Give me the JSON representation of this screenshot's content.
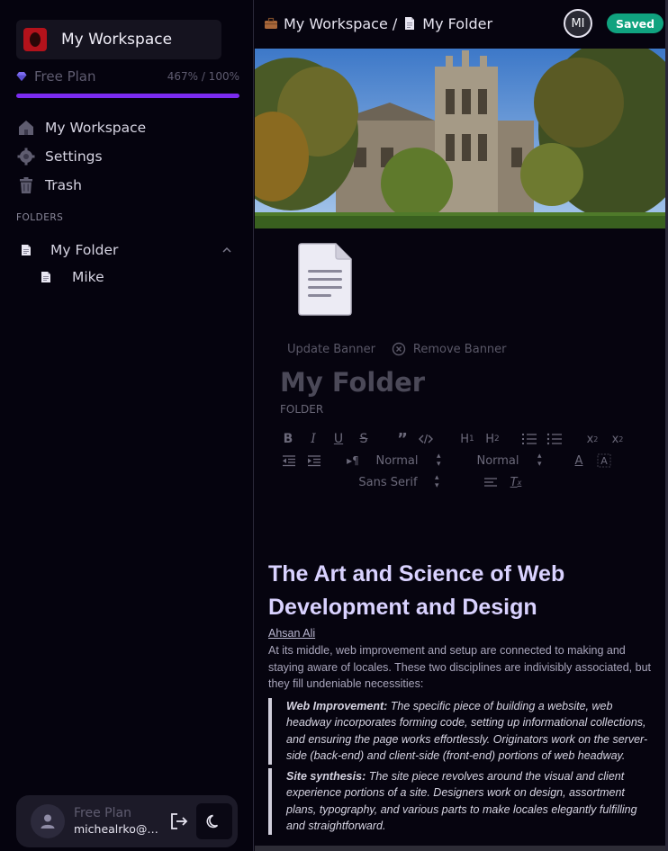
{
  "sidebar": {
    "workspace_name": "My Workspace",
    "plan": {
      "label": "Free Plan",
      "usage": "467% / 100%",
      "progress_fraction": 1.0
    },
    "nav": [
      {
        "label": "My Workspace",
        "icon": "home-icon"
      },
      {
        "label": "Settings",
        "icon": "gear-icon"
      },
      {
        "label": "Trash",
        "icon": "trash-icon"
      }
    ],
    "folders_title": "FOLDERS",
    "folder": {
      "label": "My Folder",
      "icon": "document-icon",
      "expanded": true
    },
    "files": [
      {
        "label": "Mike",
        "icon": "document-icon"
      }
    ],
    "user": {
      "plan": "Free Plan",
      "email": "michealrko@g..."
    }
  },
  "topbar": {
    "breadcrumb": [
      {
        "label": "My Workspace /",
        "icon": "briefcase-icon"
      },
      {
        "label": "My Folder",
        "icon": "document-icon"
      }
    ],
    "avatar_initials": "MI",
    "status": "Saved"
  },
  "editor": {
    "update_banner": "Update Banner",
    "remove_banner": "Remove Banner",
    "title": "My Folder",
    "subtitle": "FOLDER",
    "toolbar": {
      "size_select": "Normal",
      "header_select": "Normal",
      "font_select": "Sans Serif"
    }
  },
  "article": {
    "title": "The Art and Science of Web Development and Design",
    "author": "Ahsan Ali",
    "intro": "At its middle, web improvement and setup are connected to making and staying aware of locales. These two disciplines are indivisibly associated, but they fill undeniable necessities:",
    "quotes": [
      {
        "lead": "Web Improvement:",
        "text": " The specific piece of building a website, web headway incorporates forming code, setting up informational collections, and ensuring the page works effortlessly. Originators work on the server-side (back-end) and client-side (front-end) portions of web headway."
      },
      {
        "lead": "Site synthesis:",
        "text": " The site piece revolves around the visual and client experience portions of a site. Designers work on design, assortment plans, typography, and various parts to make locales elegantly fulfilling and straightforward."
      }
    ]
  },
  "colors": {
    "accent": "#7b2bf0",
    "saved_badge": "#10a37f",
    "article_title": "#d9d2ff"
  }
}
